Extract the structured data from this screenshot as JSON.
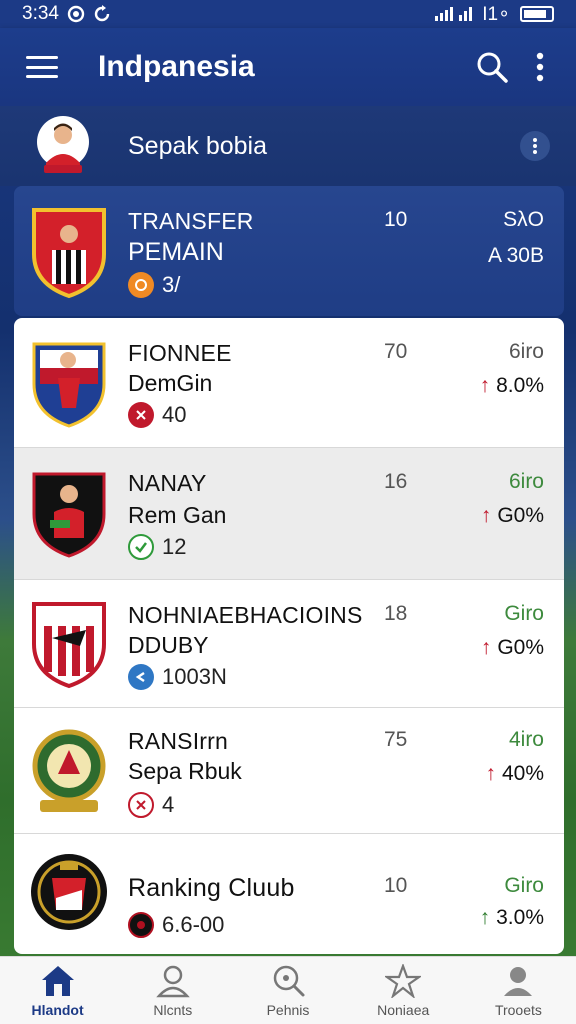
{
  "status": {
    "time": "3:34",
    "network": "I1∘"
  },
  "app": {
    "title": "Indpanesia"
  },
  "subheader": {
    "title": "Sepak bobia"
  },
  "highlight": {
    "name": "TRANSFER",
    "sub": "PEMAIN",
    "meta": "3/",
    "count": "10",
    "top": "SλO",
    "change": "A 30B"
  },
  "rows": [
    {
      "name": "FIONNEE",
      "sub": "DemGin",
      "meta": "40",
      "count": "70",
      "top": "6iro",
      "change": "8.0%",
      "arrow": "↑",
      "arrow_color": "#c0192c",
      "badge_color": "#c0192c"
    },
    {
      "name": "NANAY",
      "sub": "Rem Gan",
      "meta": "12",
      "count": "16",
      "top": "6iro",
      "change": "G0%",
      "arrow": "↑",
      "arrow_color": "#c0192c",
      "badge_color": "#2e9a3a"
    },
    {
      "name": "NOHNIAEBHACIOINS",
      "sub": "DDUBY",
      "meta": "1003N",
      "count": "18",
      "top": "Giro",
      "change": "G0%",
      "arrow": "↑",
      "arrow_color": "#c0192c",
      "badge_color": "#2f77c4"
    },
    {
      "name": "RANSIrrn",
      "sub": "Sepa Rbuk",
      "meta": "4",
      "count": "75",
      "top": "4iro",
      "change": "40%",
      "arrow": "↑",
      "arrow_color": "#c0192c",
      "badge_color": "#c0192c"
    },
    {
      "name": "Ranking Cluub",
      "sub": "",
      "meta": "6.6-00",
      "count": "10",
      "top": "Giro",
      "change": "3.0%",
      "arrow": "↑",
      "arrow_color": "#2e7d2e",
      "badge_color": "#b01020"
    }
  ],
  "nav": [
    {
      "label": "Hlandot",
      "icon": "home-icon"
    },
    {
      "label": "Nlcnts",
      "icon": "person-icon"
    },
    {
      "label": "Pehnis",
      "icon": "search-icon"
    },
    {
      "label": "Noniaea",
      "icon": "star-icon"
    },
    {
      "label": "Trooets",
      "icon": "profile-icon"
    }
  ]
}
